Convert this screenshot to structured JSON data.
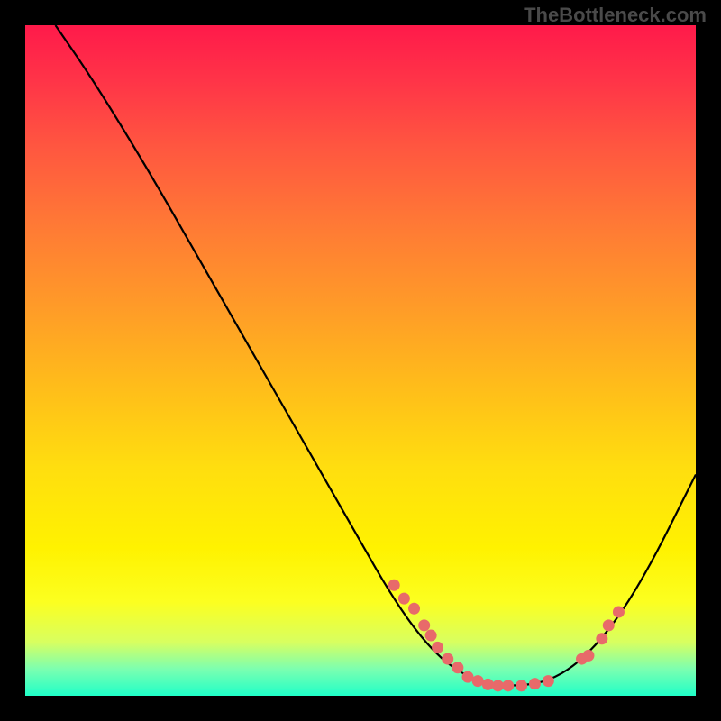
{
  "watermark": "TheBottleneck.com",
  "chart_data": {
    "type": "line",
    "title": "",
    "xlabel": "",
    "ylabel": "",
    "xlim": [
      0,
      100
    ],
    "ylim": [
      0,
      100
    ],
    "curve": [
      {
        "x": 4.5,
        "y": 100
      },
      {
        "x": 10,
        "y": 92
      },
      {
        "x": 18,
        "y": 79
      },
      {
        "x": 26,
        "y": 65
      },
      {
        "x": 34,
        "y": 51
      },
      {
        "x": 42,
        "y": 37
      },
      {
        "x": 50,
        "y": 23
      },
      {
        "x": 54,
        "y": 16
      },
      {
        "x": 58,
        "y": 10
      },
      {
        "x": 62,
        "y": 5.5
      },
      {
        "x": 66,
        "y": 2.8
      },
      {
        "x": 70,
        "y": 1.6
      },
      {
        "x": 74,
        "y": 1.5
      },
      {
        "x": 78,
        "y": 2.2
      },
      {
        "x": 82,
        "y": 4.5
      },
      {
        "x": 86,
        "y": 8.5
      },
      {
        "x": 90,
        "y": 14
      },
      {
        "x": 94,
        "y": 21
      },
      {
        "x": 98,
        "y": 29
      },
      {
        "x": 100,
        "y": 33
      }
    ],
    "markers": [
      {
        "x": 55,
        "y": 16.5
      },
      {
        "x": 56.5,
        "y": 14.5
      },
      {
        "x": 58,
        "y": 13
      },
      {
        "x": 59.5,
        "y": 10.5
      },
      {
        "x": 60.5,
        "y": 9
      },
      {
        "x": 61.5,
        "y": 7.2
      },
      {
        "x": 63,
        "y": 5.5
      },
      {
        "x": 64.5,
        "y": 4.2
      },
      {
        "x": 66,
        "y": 2.8
      },
      {
        "x": 67.5,
        "y": 2.2
      },
      {
        "x": 69,
        "y": 1.7
      },
      {
        "x": 70.5,
        "y": 1.5
      },
      {
        "x": 72,
        "y": 1.5
      },
      {
        "x": 74,
        "y": 1.5
      },
      {
        "x": 76,
        "y": 1.8
      },
      {
        "x": 78,
        "y": 2.2
      },
      {
        "x": 83,
        "y": 5.5
      },
      {
        "x": 84,
        "y": 6
      },
      {
        "x": 86,
        "y": 8.5
      },
      {
        "x": 87,
        "y": 10.5
      },
      {
        "x": 88.5,
        "y": 12.5
      }
    ]
  }
}
